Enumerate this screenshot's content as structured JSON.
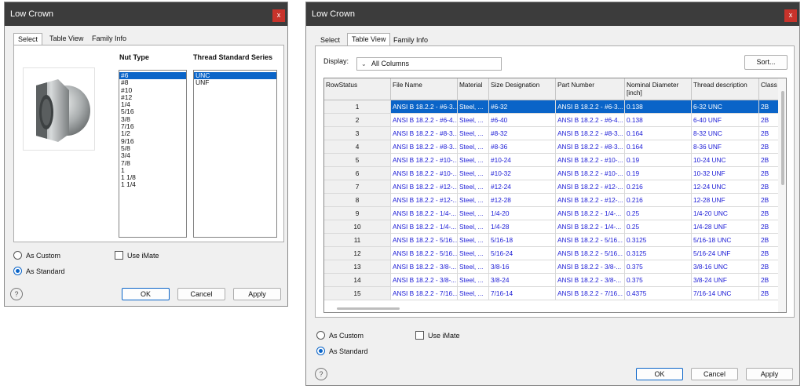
{
  "left": {
    "title": "Low Crown",
    "close": "x",
    "tabs": [
      "Select",
      "Table View",
      "Family Info"
    ],
    "nut_type_header": "Nut Type",
    "thread_header": "Thread Standard Series",
    "nut_types": [
      "#6",
      "#8",
      "#10",
      "#12",
      "1/4",
      "5/16",
      "3/8",
      "7/16",
      "1/2",
      "9/16",
      "5/8",
      "3/4",
      "7/8",
      "1",
      "1 1/8",
      "1 1/4"
    ],
    "threads": [
      "UNC",
      "UNF"
    ],
    "as_custom": "As Custom",
    "as_standard": "As Standard",
    "use_imate": "Use iMate",
    "ok": "OK",
    "cancel": "Cancel",
    "apply": "Apply",
    "help": "?"
  },
  "right": {
    "title": "Low Crown",
    "close": "x",
    "tabs": [
      "Select",
      "Table View",
      "Family Info"
    ],
    "display_label": "Display:",
    "display_value": "All Columns",
    "sort": "Sort...",
    "columns": [
      "RowStatus",
      "File Name",
      "Material",
      "Size Designation",
      "Part Number",
      "Nominal Diameter [inch]",
      "Thread description",
      "Class"
    ],
    "rows": [
      [
        "1",
        "ANSI B 18.2.2 - #6-3...",
        "Steel, ...",
        "#6-32",
        "ANSI B 18.2.2 - #6-3...",
        "0.138",
        "6-32 UNC",
        "2B"
      ],
      [
        "2",
        "ANSI B 18.2.2 - #6-4...",
        "Steel, ...",
        "#6-40",
        "ANSI B 18.2.2 - #6-4...",
        "0.138",
        "6-40 UNF",
        "2B"
      ],
      [
        "3",
        "ANSI B 18.2.2 - #8-3...",
        "Steel, ...",
        "#8-32",
        "ANSI B 18.2.2 - #8-3...",
        "0.164",
        "8-32 UNC",
        "2B"
      ],
      [
        "4",
        "ANSI B 18.2.2 - #8-3...",
        "Steel, ...",
        "#8-36",
        "ANSI B 18.2.2 - #8-3...",
        "0.164",
        "8-36 UNF",
        "2B"
      ],
      [
        "5",
        "ANSI B 18.2.2 - #10-...",
        "Steel, ...",
        "#10-24",
        "ANSI B 18.2.2 - #10-...",
        "0.19",
        "10-24 UNC",
        "2B"
      ],
      [
        "6",
        "ANSI B 18.2.2 - #10-...",
        "Steel, ...",
        "#10-32",
        "ANSI B 18.2.2 - #10-...",
        "0.19",
        "10-32 UNF",
        "2B"
      ],
      [
        "7",
        "ANSI B 18.2.2 - #12-...",
        "Steel, ...",
        "#12-24",
        "ANSI B 18.2.2 - #12-...",
        "0.216",
        "12-24 UNC",
        "2B"
      ],
      [
        "8",
        "ANSI B 18.2.2 - #12-...",
        "Steel, ...",
        "#12-28",
        "ANSI B 18.2.2 - #12-...",
        "0.216",
        "12-28 UNF",
        "2B"
      ],
      [
        "9",
        "ANSI B 18.2.2 - 1/4-...",
        "Steel, ...",
        "1/4-20",
        "ANSI B 18.2.2 - 1/4-...",
        "0.25",
        "1/4-20 UNC",
        "2B"
      ],
      [
        "10",
        "ANSI B 18.2.2 - 1/4-...",
        "Steel, ...",
        "1/4-28",
        "ANSI B 18.2.2 - 1/4-...",
        "0.25",
        "1/4-28 UNF",
        "2B"
      ],
      [
        "11",
        "ANSI B 18.2.2 - 5/16...",
        "Steel, ...",
        "5/16-18",
        "ANSI B 18.2.2 - 5/16...",
        "0.3125",
        "5/16-18 UNC",
        "2B"
      ],
      [
        "12",
        "ANSI B 18.2.2 - 5/16...",
        "Steel, ...",
        "5/16-24",
        "ANSI B 18.2.2 - 5/16...",
        "0.3125",
        "5/16-24 UNF",
        "2B"
      ],
      [
        "13",
        "ANSI B 18.2.2 - 3/8-...",
        "Steel, ...",
        "3/8-16",
        "ANSI B 18.2.2 - 3/8-...",
        "0.375",
        "3/8-16 UNC",
        "2B"
      ],
      [
        "14",
        "ANSI B 18.2.2 - 3/8-...",
        "Steel, ...",
        "3/8-24",
        "ANSI B 18.2.2 - 3/8-...",
        "0.375",
        "3/8-24 UNF",
        "2B"
      ],
      [
        "15",
        "ANSI B 18.2.2 - 7/16...",
        "Steel, ...",
        "7/16-14",
        "ANSI B 18.2.2 - 7/16...",
        "0.4375",
        "7/16-14 UNC",
        "2B"
      ]
    ],
    "as_custom": "As Custom",
    "as_standard": "As Standard",
    "use_imate": "Use iMate",
    "ok": "OK",
    "cancel": "Cancel",
    "apply": "Apply",
    "help": "?"
  },
  "colors": {
    "titlebar": "#3c3c3c",
    "close": "#c8332b",
    "selection": "#0a64c8",
    "link": "#1a1ad6"
  }
}
